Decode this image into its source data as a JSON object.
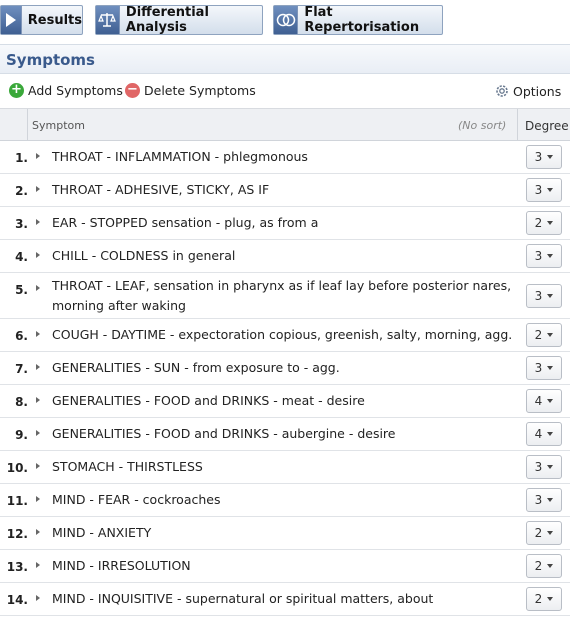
{
  "toolbar": {
    "results_label": "Results",
    "differential_label": "Differential Analysis",
    "flat_label": "Flat Repertorisation"
  },
  "panel": {
    "title": "Symptoms",
    "add_label": "Add Symptoms",
    "delete_label": "Delete Symptoms",
    "options_label": "Options"
  },
  "table": {
    "col_symptom": "Symptom",
    "sort_status": "(No sort)",
    "col_degree": "Degree"
  },
  "colors": {
    "accent": "#3a5a8c",
    "add": "#3aa83a",
    "delete": "#e06666"
  },
  "rows": [
    {
      "num": "1.",
      "text": "THROAT - INFLAMMATION - phlegmonous",
      "degree": "3"
    },
    {
      "num": "2.",
      "text": "THROAT - ADHESIVE, STICKY, AS IF",
      "degree": "3"
    },
    {
      "num": "3.",
      "text": "EAR - STOPPED sensation - plug, as from a",
      "degree": "2"
    },
    {
      "num": "4.",
      "text": "CHILL - COLDNESS in general",
      "degree": "3"
    },
    {
      "num": "5.",
      "text": "THROAT - LEAF, sensation in pharynx as if leaf lay before posterior nares, morning after waking",
      "degree": "3"
    },
    {
      "num": "6.",
      "text": "COUGH - DAYTIME - expectoration copious, greenish, salty, morning, agg.",
      "degree": "2"
    },
    {
      "num": "7.",
      "text": "GENERALITIES - SUN - from exposure to - agg.",
      "degree": "3"
    },
    {
      "num": "8.",
      "text": "GENERALITIES - FOOD and DRINKS - meat - desire",
      "degree": "4"
    },
    {
      "num": "9.",
      "text": "GENERALITIES - FOOD and DRINKS - aubergine - desire",
      "degree": "4"
    },
    {
      "num": "10.",
      "text": "STOMACH - THIRSTLESS",
      "degree": "3"
    },
    {
      "num": "11.",
      "text": "MIND - FEAR - cockroaches",
      "degree": "3"
    },
    {
      "num": "12.",
      "text": "MIND - ANXIETY",
      "degree": "2"
    },
    {
      "num": "13.",
      "text": "MIND - IRRESOLUTION",
      "degree": "2"
    },
    {
      "num": "14.",
      "text": "MIND - INQUISITIVE - supernatural or spiritual matters, about",
      "degree": "2"
    }
  ]
}
